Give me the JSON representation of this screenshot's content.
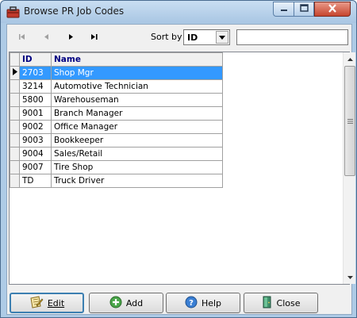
{
  "window": {
    "title": "Browse PR Job Codes",
    "app_icon": "toolbox-icon",
    "caption_buttons": [
      "minimize-icon",
      "maximize-icon",
      "close-icon"
    ]
  },
  "toolbar": {
    "nav": [
      {
        "name": "first-record-icon",
        "enabled": false
      },
      {
        "name": "prev-record-icon",
        "enabled": false
      },
      {
        "name": "next-record-icon",
        "enabled": true
      },
      {
        "name": "last-record-icon",
        "enabled": true
      }
    ],
    "sort_label": "Sort by",
    "sort_value": "ID",
    "search_value": ""
  },
  "grid": {
    "columns": [
      "ID",
      "Name"
    ],
    "selected_index": 0,
    "rows": [
      {
        "id": "2703",
        "name": "Shop Mgr"
      },
      {
        "id": "3214",
        "name": "Automotive Technician"
      },
      {
        "id": "5800",
        "name": "Warehouseman"
      },
      {
        "id": "9001",
        "name": "Branch Manager"
      },
      {
        "id": "9002",
        "name": "Office Manager"
      },
      {
        "id": "9003",
        "name": "Bookkeeper"
      },
      {
        "id": "9004",
        "name": "Sales/Retail"
      },
      {
        "id": "9007",
        "name": "Tire Shop"
      },
      {
        "id": "TD",
        "name": "Truck Driver"
      }
    ]
  },
  "buttons": {
    "edit": {
      "label": "Edit",
      "icon": "edit-note-icon"
    },
    "add": {
      "label": "Add",
      "icon": "add-circle-icon"
    },
    "help": {
      "label": "Help",
      "icon": "help-circle-icon"
    },
    "close": {
      "label": "Close",
      "icon": "exit-door-icon"
    }
  },
  "colors": {
    "selection": "#3399ff",
    "header_text": "#000080",
    "title_bar": "#aecbe6"
  }
}
